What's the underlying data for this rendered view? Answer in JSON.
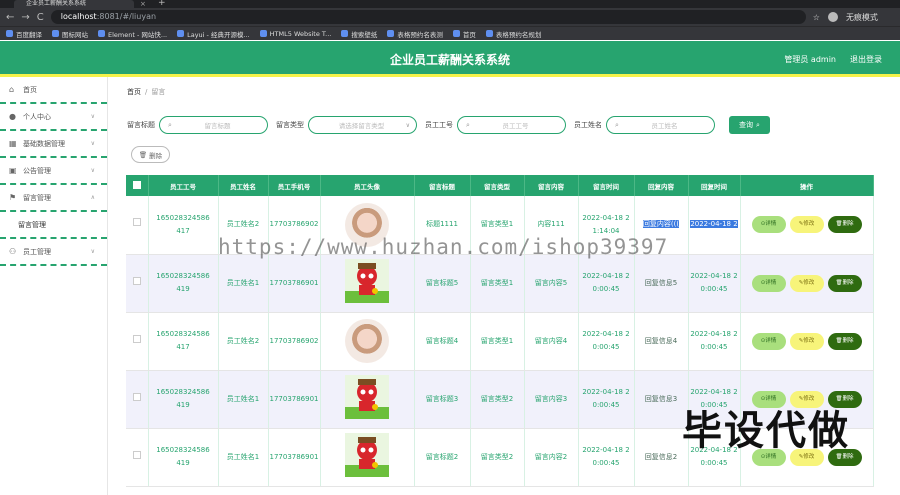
{
  "browser": {
    "tab_title": "企业员工薪酬关系系统",
    "tab_close": "×",
    "tab_new": "+",
    "nav_back": "←",
    "nav_forward": "→",
    "nav_reload": "C",
    "url_host": "localhost",
    "url_rest": ":8081/#/liuyan",
    "profile_label": "无痕模式",
    "bookmarks": [
      "百度翻译",
      "图标网站",
      "Element - 网站快...",
      "Layui - 经典开源模...",
      "HTML5 Website T...",
      "搜索壁纸",
      "表格预约名表测",
      "首页",
      "表格预约名规划"
    ]
  },
  "header": {
    "title": "企业员工薪酬关系系统",
    "admin_label": "管理员 admin",
    "logout_label": "退出登录"
  },
  "sidebar": {
    "items": [
      {
        "label": "首页",
        "icon": "home-icon"
      },
      {
        "label": "个人中心",
        "icon": "user-icon"
      },
      {
        "label": "基础数据管理",
        "icon": "grid-icon"
      },
      {
        "label": "公告管理",
        "icon": "notice-icon"
      },
      {
        "label": "留言管理",
        "icon": "flag-icon"
      },
      {
        "label": "留言管理",
        "icon": ""
      },
      {
        "label": "员工管理",
        "icon": "staff-icon"
      }
    ]
  },
  "breadcrumb": {
    "home": "首页",
    "sep": "/",
    "current": "留言"
  },
  "filters": {
    "title_label": "留言标题",
    "title_ph": "留言标题",
    "type_label": "留言类型",
    "type_ph": "请选择留言类型",
    "no_label": "员工工号",
    "no_ph": "员工工号",
    "name_label": "员工姓名",
    "name_ph": "员工姓名",
    "search_label": "查询",
    "delete_label": "删除"
  },
  "table": {
    "headers": [
      "员工工号",
      "员工姓名",
      "员工手机号",
      "员工头像",
      "留言标题",
      "留言类型",
      "留言内容",
      "留言时间",
      "回复内容",
      "回复时间",
      "操作"
    ],
    "rows": [
      {
        "no1": "165028324586",
        "no2": "417",
        "name": "员工姓名2",
        "phone": "17703786902",
        "avatar": "girl",
        "title": "标题1111",
        "type": "留言类型1",
        "content": "内容111",
        "t1": "2022-04-18 2",
        "t2": "1:14:04",
        "reply": "回复内容(((",
        "r1": "2022-04-18 2",
        "r2": "",
        "alt": false
      },
      {
        "no1": "165028324586",
        "no2": "419",
        "name": "员工姓名1",
        "phone": "17703786901",
        "avatar": "cartoon",
        "title": "留言标题5",
        "type": "留言类型1",
        "content": "留言内容5",
        "t1": "2022-04-18 2",
        "t2": "0:00:45",
        "reply": "回复信息5",
        "r1": "2022-04-18 2",
        "r2": "0:00:45",
        "alt": true
      },
      {
        "no1": "165028324586",
        "no2": "417",
        "name": "员工姓名2",
        "phone": "17703786902",
        "avatar": "girl",
        "title": "留言标题4",
        "type": "留言类型1",
        "content": "留言内容4",
        "t1": "2022-04-18 2",
        "t2": "0:00:45",
        "reply": "回复信息4",
        "r1": "2022-04-18 2",
        "r2": "0:00:45",
        "alt": false
      },
      {
        "no1": "165028324586",
        "no2": "419",
        "name": "员工姓名1",
        "phone": "17703786901",
        "avatar": "cartoon",
        "title": "留言标题3",
        "type": "留言类型2",
        "content": "留言内容3",
        "t1": "2022-04-18 2",
        "t2": "0:00:45",
        "reply": "回复信息3",
        "r1": "2022-04-18 2",
        "r2": "0:00:45",
        "alt": true
      },
      {
        "no1": "165028324586",
        "no2": "419",
        "name": "员工姓名1",
        "phone": "17703786901",
        "avatar": "cartoon",
        "title": "留言标题2",
        "type": "留言类型2",
        "content": "留言内容2",
        "t1": "2022-04-18 2",
        "t2": "0:00:45",
        "reply": "回复信息2",
        "r1": "2022-04-18 2",
        "r2": "0:00:45",
        "alt": false
      }
    ],
    "actions": {
      "detail": "详情",
      "edit": "修改",
      "del": "删除"
    }
  },
  "watermark": {
    "url": "https://www.huzhan.com/ishop39397",
    "cn": "毕设代做"
  },
  "colors": {
    "primary": "#27a46f",
    "accent": "#f5f24a",
    "detail": "#a9df7d",
    "edit": "#f7f47a",
    "delete": "#2f6b10"
  }
}
